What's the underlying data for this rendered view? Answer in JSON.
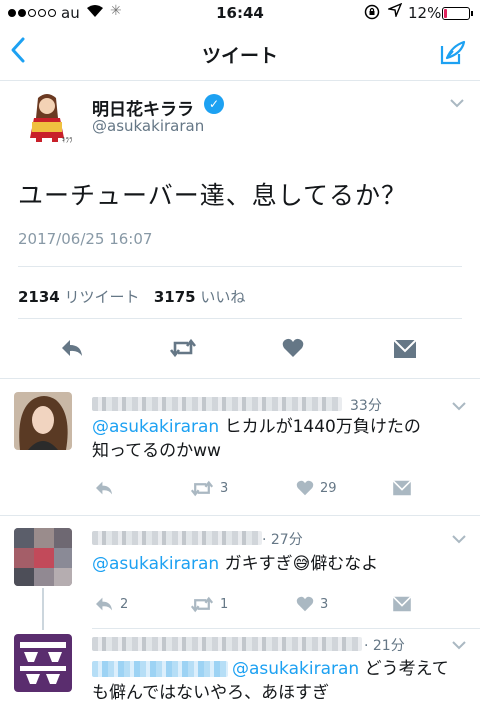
{
  "status_bar": {
    "carrier": "au",
    "time": "16:44",
    "battery_percent": "12%",
    "battery_level": 0.12,
    "battery_color": "#e0245e"
  },
  "nav": {
    "back_icon": "chevron-left-icon",
    "title": "ツイート",
    "compose_icon": "compose-tweet-icon"
  },
  "tweet": {
    "author_name": "明日花キララ",
    "author_handle": "@asukakiraran",
    "verified": true,
    "text": "ユーチューバー達、息してるか？",
    "timestamp": "2017/06/25 16:07",
    "retweet_count": "2134",
    "retweet_label": "リツイート",
    "like_count": "3175",
    "like_label": "いいね"
  },
  "replies": [
    {
      "time": "33分",
      "mention": "@asukakiraran",
      "text_line1": " ヒカルが1440万負けたの",
      "text_line2": "知ってるのかww",
      "reply_count": "",
      "retweet_count": "3",
      "like_count": "29"
    },
    {
      "time": "· 27分",
      "mention": "@asukakiraran",
      "text_a": " ガキすぎ",
      "emoji": "😅",
      "text_b": "僻むなよ",
      "reply_count": "2",
      "retweet_count": "1",
      "like_count": "3"
    },
    {
      "time": "· 21分",
      "mention": "@asukakiraran",
      "text_line1": " どう考えて",
      "text_line2": "も僻んではないやろ、あほすぎ"
    }
  ],
  "colors": {
    "accent": "#1da1f2",
    "muted": "#657786",
    "divider": "#e1e8ed"
  }
}
